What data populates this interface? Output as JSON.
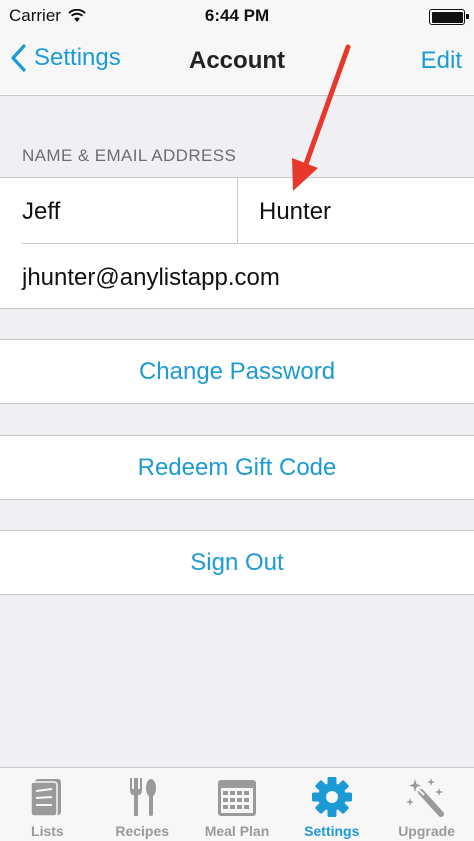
{
  "status_bar": {
    "carrier": "Carrier",
    "time": "6:44 PM"
  },
  "nav": {
    "back_label": "Settings",
    "title": "Account",
    "edit_label": "Edit"
  },
  "section": {
    "header": "NAME & EMAIL ADDRESS"
  },
  "account": {
    "first_name": "Jeff",
    "last_name": "Hunter",
    "email": "jhunter@anylistapp.com"
  },
  "actions": {
    "change_password": "Change Password",
    "redeem_gift_code": "Redeem Gift Code",
    "sign_out": "Sign Out"
  },
  "tabs": [
    {
      "label": "Lists",
      "icon": "lists-icon"
    },
    {
      "label": "Recipes",
      "icon": "fork-spoon-icon"
    },
    {
      "label": "Meal Plan",
      "icon": "calendar-icon"
    },
    {
      "label": "Settings",
      "icon": "gear-icon",
      "active": true
    },
    {
      "label": "Upgrade",
      "icon": "magic-wand-icon"
    }
  ],
  "colors": {
    "accent": "#1b9ad6",
    "background": "#efeff4",
    "annotation_arrow": "#e8372c",
    "tab_inactive": "#9a9a9a"
  }
}
